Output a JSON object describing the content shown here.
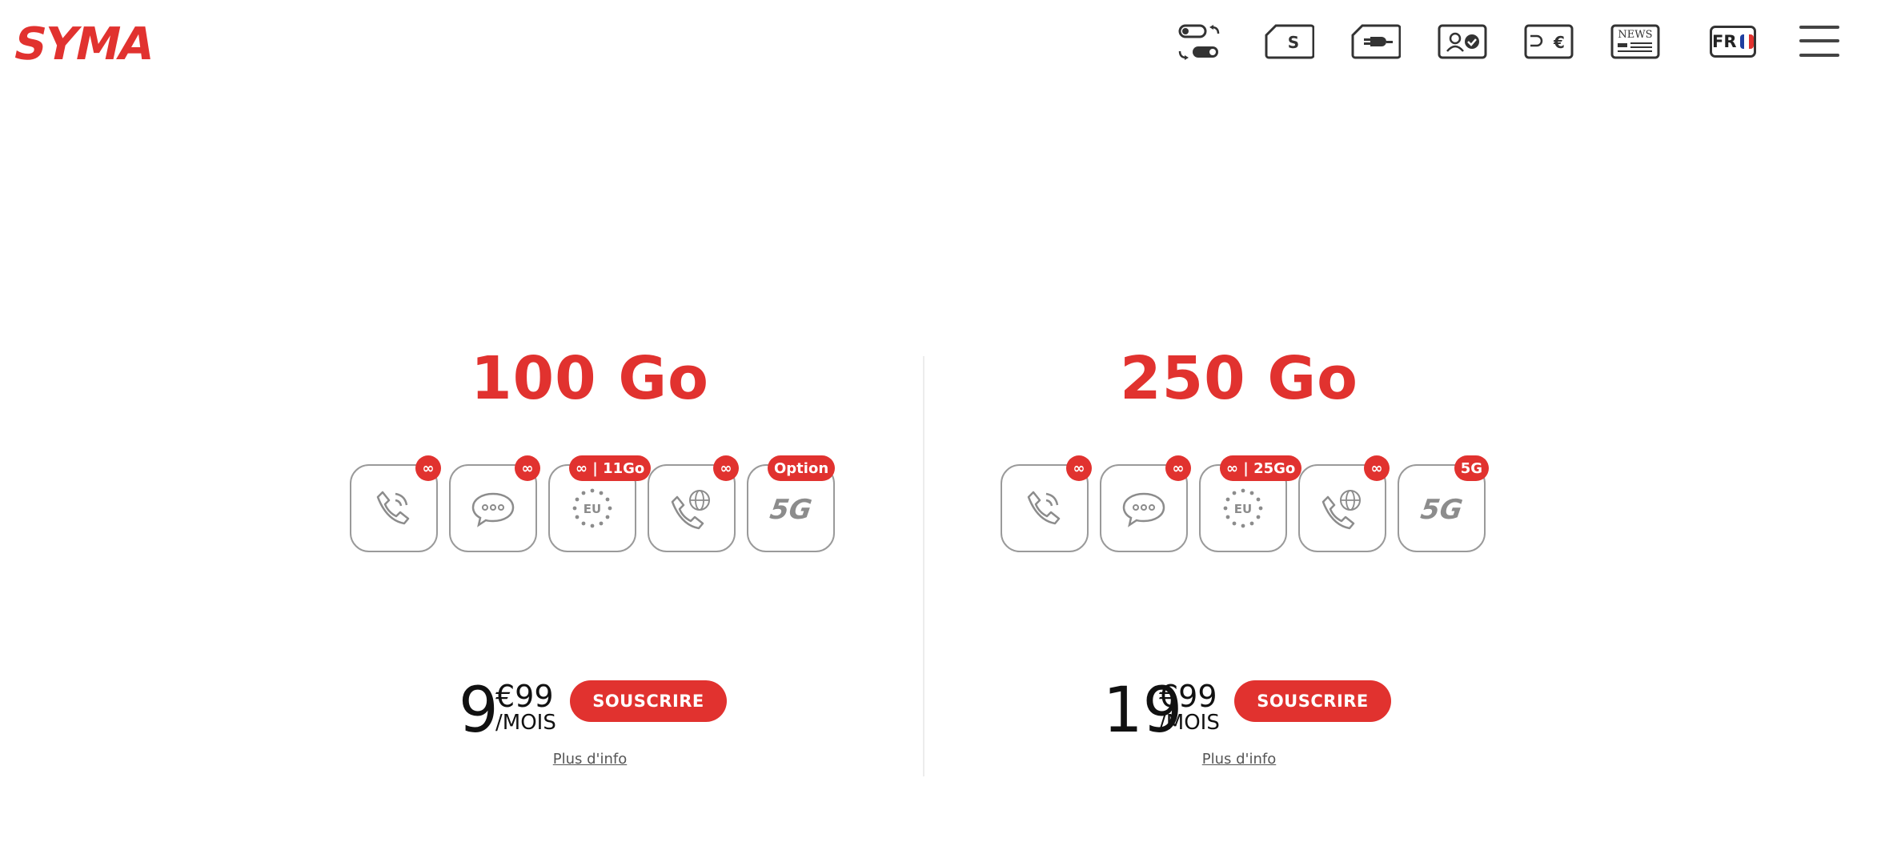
{
  "header": {
    "logo": "SYMA",
    "language": "FR",
    "icons": [
      "switch-toggle-icon",
      "sim-card-icon",
      "sim-plug-icon",
      "account-check-icon",
      "recharge-euro-icon",
      "news-icon",
      "language-flag-icon",
      "menu-icon"
    ],
    "news_icon_label": "NEWS",
    "sim_icon_label": "S",
    "recharge_icon_label": "€"
  },
  "plans": [
    {
      "title": "100 Go",
      "features": [
        {
          "icon": "phone-call-icon",
          "badge": "∞"
        },
        {
          "icon": "sms-bubble-icon",
          "badge": "∞"
        },
        {
          "icon": "eu-stars-icon",
          "badge": "∞ | 11Go",
          "icon_label": "EU"
        },
        {
          "icon": "international-call-icon",
          "badge": "∞"
        },
        {
          "icon": "5g-icon",
          "badge": "Option",
          "icon_label": "5G"
        }
      ],
      "price_integer": "9",
      "price_currency_cents": "€99",
      "price_period": "/MOIS",
      "subscribe_label": "SOUSCRIRE",
      "more_info_label": "Plus d'info"
    },
    {
      "title": "250 Go",
      "features": [
        {
          "icon": "phone-call-icon",
          "badge": "∞"
        },
        {
          "icon": "sms-bubble-icon",
          "badge": "∞"
        },
        {
          "icon": "eu-stars-icon",
          "badge": "∞ | 25Go",
          "icon_label": "EU"
        },
        {
          "icon": "international-call-icon",
          "badge": "∞"
        },
        {
          "icon": "5g-icon",
          "badge": "5G",
          "icon_label": "5G"
        }
      ],
      "price_integer": "19",
      "price_currency_cents": "€99",
      "price_period": "/MOIS",
      "subscribe_label": "SOUSCRIRE",
      "more_info_label": "Plus d'info"
    }
  ],
  "colors": {
    "brand_red": "#e1322f",
    "icon_gray": "#8c8c8c",
    "border_gray": "#9a9a9a",
    "text_dark": "#111111",
    "flag_blue": "#1f3fa0",
    "flag_red": "#e1322f"
  }
}
